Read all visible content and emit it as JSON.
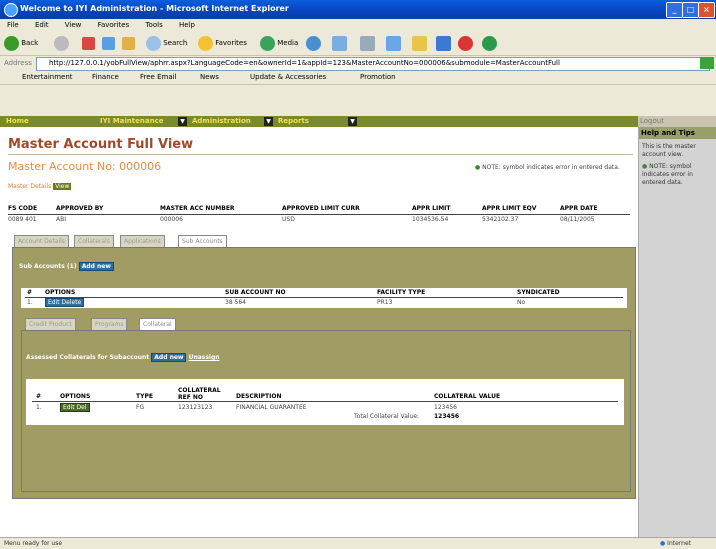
{
  "window": {
    "title": "Welcome to IYI Administration - Microsoft Internet Explorer"
  },
  "menu": [
    "File",
    "Edit",
    "View",
    "Favorites",
    "Tools",
    "Help"
  ],
  "toolbar": {
    "back": "Back",
    "search": "Search",
    "favorites": "Favorites",
    "media": "Media"
  },
  "address": {
    "label": "Address",
    "url": "http://127.0.0.1/yobFullView/aphrr.aspx?LanguageCode=en&ownerId=1&appId=123&MasterAccountNo=000006&submodule=MasterAccountFull"
  },
  "links": [
    "Entertainment",
    "Finance",
    "Free Email",
    "News",
    "Update & Accessories",
    "Promotion"
  ],
  "app_nav": {
    "items": [
      "Home",
      "IYI Maintenance",
      "Administration",
      "Reports"
    ],
    "right": "Logout"
  },
  "page": {
    "title": "Master Account Full View",
    "subtitle": "Master Account No: 000006",
    "note": "NOTE:  symbol indicates error in entered data.",
    "return_link": "Master Details",
    "return_btn": "View"
  },
  "master": {
    "headers": [
      "FS CODE",
      "APPROVED BY",
      "MASTER ACC NUMBER",
      "APPROVED LIMIT CURR",
      "APPR LIMIT",
      "APPR LIMIT EQV",
      "APPR DATE"
    ],
    "values": [
      "0089 401",
      "ABI",
      "000006",
      "USD",
      "1034536.54",
      "5342102.37",
      "08/11/2005"
    ]
  },
  "main_tabs": [
    "Account Details",
    "Collaterals",
    "Applications",
    "Sub Accounts"
  ],
  "sub_accounts": {
    "title": "Sub Accounts (1)",
    "add": "Add new",
    "headers": [
      "#",
      "OPTIONS",
      "SUB ACCOUNT NO",
      "FACILITY TYPE",
      "SYNDICATED"
    ],
    "rows": [
      [
        "1.",
        "Edit Delete",
        "38 564",
        "PR13",
        "No"
      ]
    ]
  },
  "sub_tabs": [
    "Credit Product",
    "Programs",
    "Collateral"
  ],
  "collateral": {
    "title": "Assessed Collaterals for Subaccount",
    "add": "Add new",
    "link": "Unassign",
    "headers": [
      "#",
      "OPTIONS",
      "TYPE",
      "COLLATERAL REF NO",
      "DESCRIPTION",
      "COLLATERAL VALUE"
    ],
    "rows": [
      [
        "1.",
        "Edit Del",
        "FG",
        "123123123",
        "FINANCIAL GUARANTEE",
        "123456"
      ]
    ],
    "total_label": "Total Collateral Value:",
    "total_value": "123456"
  },
  "help": {
    "title": "Help and Tips",
    "tips": [
      "This is the master account view.",
      "NOTE:  symbol indicates error in entered data."
    ]
  },
  "status": {
    "left": "Menu ready for use",
    "right": "Internet"
  }
}
